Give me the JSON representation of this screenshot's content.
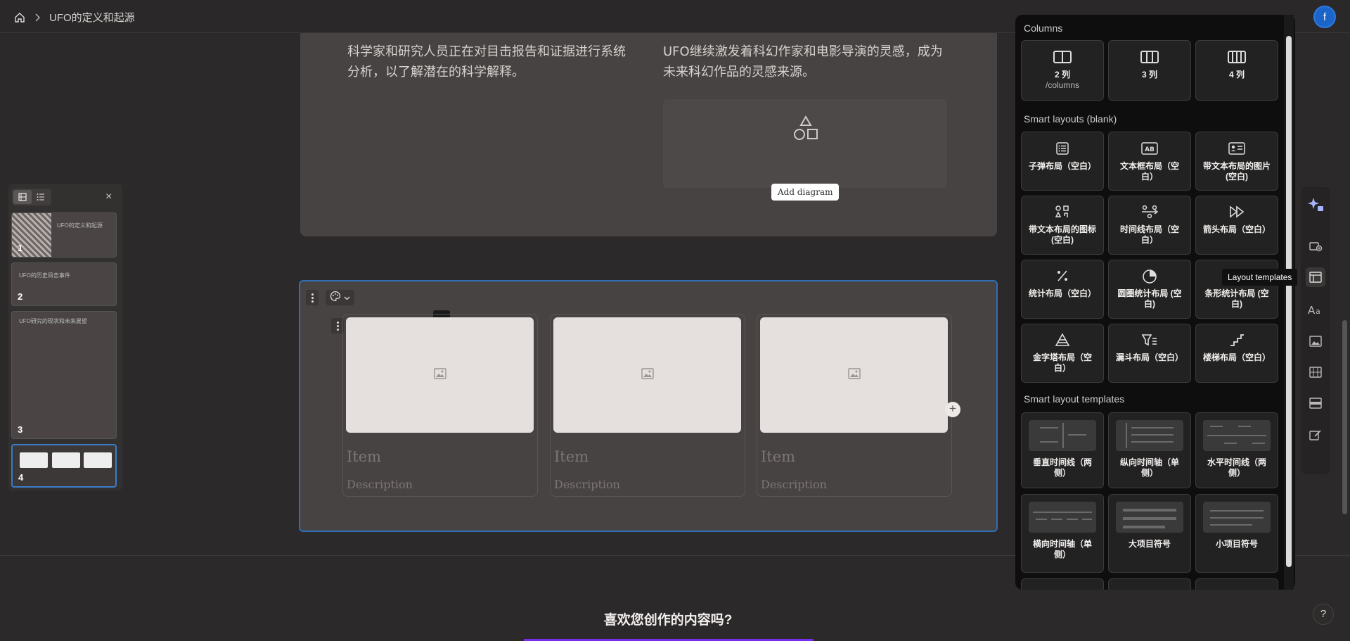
{
  "breadcrumb": {
    "title": "UFO的定义和起源"
  },
  "avatar": {
    "initial": "f"
  },
  "top_card": {
    "left_text": "科学家和研究人员正在对目击报告和证据进行系统分析，以了解潜在的科学解释。",
    "right_text": "UFO继续激发着科幻作家和电影导演的灵感，成为未来科幻作品的灵感来源。",
    "add_diagram": "Add diagram"
  },
  "selected_card": {
    "items": [
      {
        "title": "Item",
        "desc": "Description"
      },
      {
        "title": "Item",
        "desc": "Description"
      },
      {
        "title": "Item",
        "desc": "Description"
      }
    ],
    "plus": "+",
    "drag": "···"
  },
  "bottom": {
    "question": "喜欢您创作的内容吗?"
  },
  "slides_panel": {
    "close": "×",
    "slides": [
      {
        "num": "1",
        "title": "UFO的定义和起源"
      },
      {
        "num": "2",
        "title": "UFO的历史目击事件"
      },
      {
        "num": "3",
        "title": "UFO研究的现状和未来展望"
      },
      {
        "num": "4",
        "title": ""
      }
    ]
  },
  "layout_panel": {
    "columns_title": "Columns",
    "columns": [
      {
        "label": "2 列",
        "sub": "/columns"
      },
      {
        "label": "3 列",
        "sub": ""
      },
      {
        "label": "4 列",
        "sub": ""
      }
    ],
    "smart_blank_title": "Smart layouts (blank)",
    "smart_blank": [
      {
        "label": "子弹布局（空白）",
        "icon": "list-icon"
      },
      {
        "label": "文本框布局（空白）",
        "icon": "textbox-icon"
      },
      {
        "label": "带文本布局的图片 (空白)",
        "icon": "image-card-icon"
      },
      {
        "label": "带文本布局的图标 (空白)",
        "icon": "icons-grid-icon"
      },
      {
        "label": "时间线布局（空白）",
        "icon": "timeline-icon"
      },
      {
        "label": "箭头布局（空白）",
        "icon": "arrows-icon"
      },
      {
        "label": "统计布局（空白）",
        "icon": "percent-icon"
      },
      {
        "label": "圆圈统计布局 (空白)",
        "icon": "pie-icon"
      },
      {
        "label": "条形统计布局 (空白)",
        "icon": "bar-icon"
      },
      {
        "label": "金字塔布局（空白）",
        "icon": "pyramid-icon"
      },
      {
        "label": "漏斗布局（空白）",
        "icon": "funnel-icon"
      },
      {
        "label": "楼梯布局（空白）",
        "icon": "stairs-icon"
      }
    ],
    "smart_templates_title": "Smart layout templates",
    "smart_templates": [
      {
        "label": "垂直时间线（两侧）"
      },
      {
        "label": "纵向时间轴（单侧）"
      },
      {
        "label": "水平时间线（两侧）"
      },
      {
        "label": "横向时间轴（单侧）"
      },
      {
        "label": "大项目符号"
      },
      {
        "label": "小项目符号"
      }
    ]
  },
  "tooltip": {
    "text": "Layout templates"
  },
  "help": {
    "label": "?"
  },
  "colors": {
    "accent_blue": "#2f6fb3",
    "accent_purple": "#7a2cf0",
    "panel_bg": "#0e0e0e"
  }
}
